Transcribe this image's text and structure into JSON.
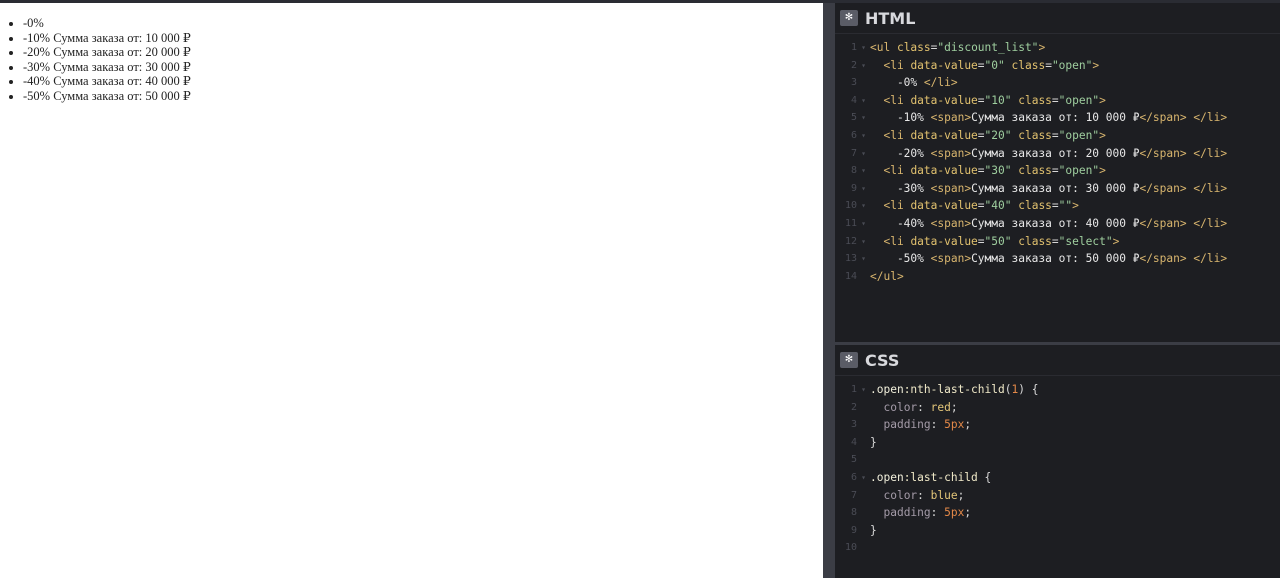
{
  "result": {
    "items": [
      "-0%",
      "-10% Сумма заказа от: 10 000 ₽",
      "-20% Сумма заказа от: 20 000 ₽",
      "-30% Сумма заказа от: 30 000 ₽",
      "-40% Сумма заказа от: 40 000 ₽",
      "-50% Сумма заказа от: 50 000 ₽"
    ]
  },
  "html_panel": {
    "title": "HTML",
    "lines": [
      {
        "n": "1",
        "t": "<ul class=\"discount_list\">"
      },
      {
        "n": "2",
        "t": "  <li data-value=\"0\" class=\"open\">"
      },
      {
        "n": "3",
        "t": "    -0% </li>"
      },
      {
        "n": "4",
        "t": "  <li data-value=\"10\" class=\"open\">"
      },
      {
        "n": "5",
        "t": "    -10% <span>Сумма заказа от: 10 000 ₽</span> </li>"
      },
      {
        "n": "6",
        "t": "  <li data-value=\"20\" class=\"open\">"
      },
      {
        "n": "7",
        "t": "    -20% <span>Сумма заказа от: 20 000 ₽</span> </li>"
      },
      {
        "n": "8",
        "t": "  <li data-value=\"30\" class=\"open\">"
      },
      {
        "n": "9",
        "t": "    -30% <span>Сумма заказа от: 30 000 ₽</span> </li>"
      },
      {
        "n": "10",
        "t": "  <li data-value=\"40\" class=\"\">"
      },
      {
        "n": "11",
        "t": "    -40% <span>Сумма заказа от: 40 000 ₽</span> </li>"
      },
      {
        "n": "12",
        "t": "  <li data-value=\"50\" class=\"select\">"
      },
      {
        "n": "13",
        "t": "    -50% <span>Сумма заказа от: 50 000 ₽</span> </li>"
      },
      {
        "n": "14",
        "t": "</ul>"
      }
    ]
  },
  "css_panel": {
    "title": "CSS",
    "lines": [
      {
        "n": "1",
        "t": ".open:nth-last-child(1) {"
      },
      {
        "n": "2",
        "t": "  color: red;"
      },
      {
        "n": "3",
        "t": "  padding: 5px;"
      },
      {
        "n": "4",
        "t": "}"
      },
      {
        "n": "5",
        "t": ""
      },
      {
        "n": "6",
        "t": ".open:last-child {"
      },
      {
        "n": "7",
        "t": "  color: blue;"
      },
      {
        "n": "8",
        "t": "  padding: 5px;"
      },
      {
        "n": "9",
        "t": "}"
      },
      {
        "n": "10",
        "t": ""
      }
    ]
  },
  "icons": {
    "settings": "gear-icon"
  }
}
